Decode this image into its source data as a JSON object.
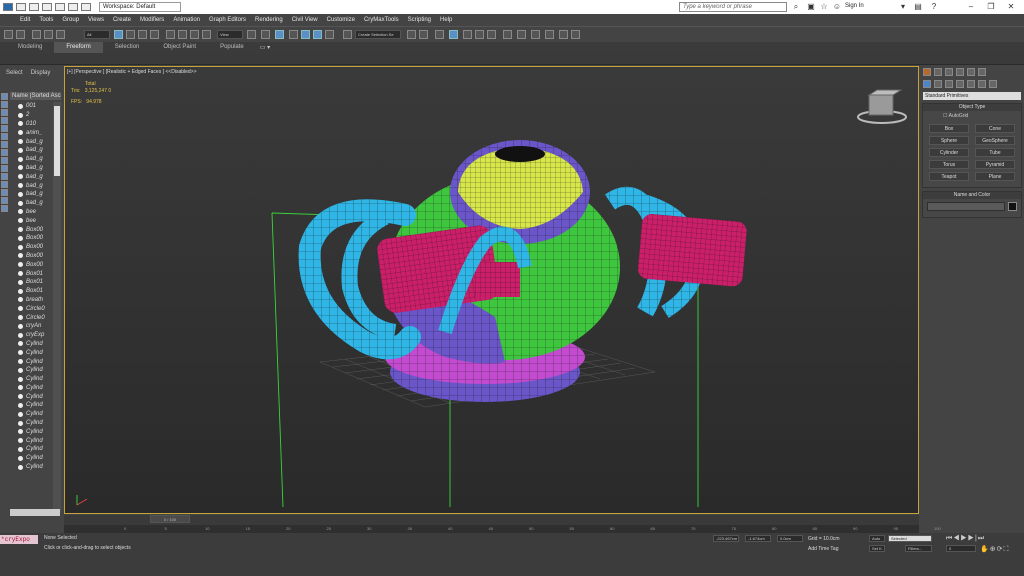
{
  "titlebar": {
    "workspace_label": "Workspace: Default",
    "search_placeholder": "Type a keyword or phrase",
    "signin_label": "Sign In"
  },
  "menu": [
    "Edit",
    "Tools",
    "Group",
    "Views",
    "Create",
    "Modifiers",
    "Animation",
    "Graph Editors",
    "Rendering",
    "Civil View",
    "Customize",
    "CryMaxTools",
    "Scripting",
    "Help"
  ],
  "toolbar": {
    "selection_filter": "All",
    "view_dropdown": "View",
    "named_sel": "Create Selection Se"
  },
  "ribbon": {
    "tabs": [
      "Modeling",
      "Freeform",
      "Selection",
      "Object Paint",
      "Populate"
    ],
    "active": "Freeform"
  },
  "explorer": {
    "select_label": "Select",
    "display_label": "Display",
    "name_column": "Name (Sorted Ascending)",
    "objects": [
      "001",
      "2",
      "010",
      "anim_",
      "bad_g",
      "bad_g",
      "bad_g",
      "bad_g",
      "bad_g",
      "bad_g",
      "bad_g",
      "bad_g",
      "bee",
      "bee",
      "Box00",
      "Box00",
      "Box00",
      "Box00",
      "Box00",
      "Box01",
      "Box01",
      "Box01",
      "breath",
      "Circle0",
      "Circle0",
      "cryAn",
      "cryExp",
      "Cylind",
      "Cylind",
      "Cylind",
      "Cylind",
      "Cylind",
      "Cylind",
      "Cylind",
      "Cylind",
      "Cylind",
      "Cylind",
      "Cylind",
      "Cylind",
      "Cylind",
      "Cylind",
      "Cylind"
    ]
  },
  "viewport": {
    "label": "[+] [Perspective ] [Realistic + Edged Faces ]  <<Disabled>>",
    "stats": {
      "total_label": "Total",
      "tris_label": "Tris:",
      "tris_value": "3,125,247 0",
      "fps_label": "FPS:",
      "fps_value": "94.978"
    }
  },
  "command_panel": {
    "category": "Standard Primitives",
    "object_type_title": "Object Type",
    "autogrid_label": "AutoGrid",
    "primitives": [
      "Box",
      "Cone",
      "Sphere",
      "GeoSphere",
      "Cylinder",
      "Tube",
      "Torus",
      "Pyramid",
      "Teapot",
      "Plane"
    ],
    "name_color_title": "Name and Color"
  },
  "timeline": {
    "frame_display": "0 / 100",
    "ticks": [
      "0",
      "5",
      "10",
      "15",
      "20",
      "25",
      "30",
      "35",
      "40",
      "45",
      "50",
      "55",
      "60",
      "65",
      "70",
      "75",
      "80",
      "85",
      "90",
      "95",
      "100"
    ]
  },
  "status": {
    "maxscript": "*cryExpo",
    "selection": "None Selected",
    "prompt": "Click or click-and-drag to select objects",
    "x_value": "-223.467cm",
    "y_value": "-1.674cm",
    "z_value": "0.0cm",
    "grid": "Grid = 10.0cm",
    "add_time_tag": "Add Time Tag",
    "auto_label": "Auto",
    "selected_label": "Selected",
    "setk_label": "Set K.",
    "filters_label": "Filters...",
    "frame_field": "0"
  },
  "colors": {
    "viewport_border": "#c7a43b",
    "mesh_green": "#3fc63f",
    "mesh_cyan": "#2fb6e6",
    "mesh_magenta": "#cc1f6a",
    "mesh_yellow": "#d7e64a",
    "mesh_purple": "#6a56c9",
    "mesh_pink": "#c24bd0"
  }
}
